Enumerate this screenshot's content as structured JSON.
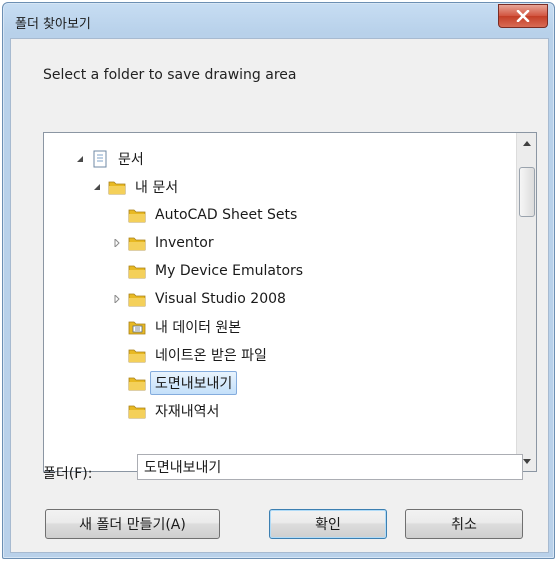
{
  "window": {
    "title": "폴더 찾아보기"
  },
  "instruction": "Select a folder to save drawing area",
  "tree": {
    "items": [
      {
        "label": "문서",
        "level": 0,
        "expander": "expanded",
        "icon": "library-icon"
      },
      {
        "label": "내 문서",
        "level": 1,
        "expander": "expanded",
        "icon": "folder-icon"
      },
      {
        "label": "AutoCAD Sheet Sets",
        "level": 2,
        "expander": "none",
        "icon": "folder-icon"
      },
      {
        "label": "Inventor",
        "level": 2,
        "expander": "collapsed",
        "icon": "folder-icon"
      },
      {
        "label": "My Device Emulators",
        "level": 2,
        "expander": "none",
        "icon": "folder-icon"
      },
      {
        "label": "Visual Studio 2008",
        "level": 2,
        "expander": "collapsed",
        "icon": "folder-icon"
      },
      {
        "label": "내 데이터 원본",
        "level": 2,
        "expander": "none",
        "icon": "data-source-icon"
      },
      {
        "label": "네이트온 받은 파일",
        "level": 2,
        "expander": "none",
        "icon": "folder-icon"
      },
      {
        "label": "도면내보내기",
        "level": 2,
        "expander": "none",
        "icon": "folder-icon",
        "selected": true
      },
      {
        "label": "자재내역서",
        "level": 2,
        "expander": "none",
        "icon": "folder-icon"
      }
    ]
  },
  "folder": {
    "label": "폴더(F):",
    "value": "도면내보내기"
  },
  "buttons": {
    "new_folder": "새 폴더 만들기(A)",
    "ok": "확인",
    "cancel": "취소"
  },
  "colors": {
    "folder": "#e8b923",
    "selection": "#c4e0fa",
    "close": "#c43e27"
  }
}
